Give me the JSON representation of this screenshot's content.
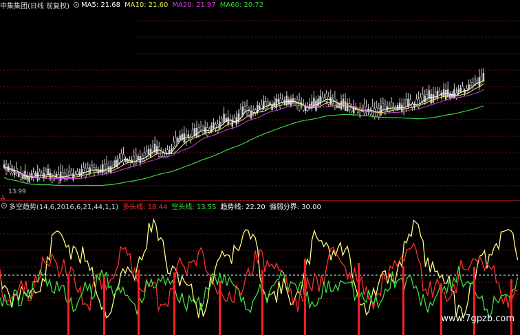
{
  "top_panel": {
    "title": "中集集团(日线 前复权)",
    "indicators": [
      {
        "label": "MA5: 21.68",
        "color": "#ffffff"
      },
      {
        "label": "MA10: 21.60",
        "color": "#e8e85a"
      },
      {
        "label": "MA20: 21.97",
        "color": "#d040d0"
      },
      {
        "label": "MA60: 20.72",
        "color": "#40d040"
      }
    ],
    "low_price_label": "13.99",
    "side_mark": "永"
  },
  "bottom_panel": {
    "title": "多空趋势(14,6,2016,6,21,44,1,1)",
    "indicators": [
      {
        "label": "多头线: 18.44",
        "color": "#ff3030"
      },
      {
        "label": "空头线: 13.55",
        "color": "#40e040"
      },
      {
        "label": "趋势线: 22.20",
        "color": "#ffffff"
      },
      {
        "label": "强弱分界: 30.00",
        "color": "#ffffff"
      }
    ]
  },
  "watermark": "www.7gpzb.com",
  "colors": {
    "grid": "#7a1010",
    "candle": "#d0d0d0",
    "ma5": "#ffffff",
    "ma10": "#e8e85a",
    "ma20": "#d040d0",
    "ma60": "#40d040",
    "long_line": "#ff3030",
    "short_line": "#40e040",
    "trend_line": "#ffff80",
    "bars": "#ff2020"
  }
}
